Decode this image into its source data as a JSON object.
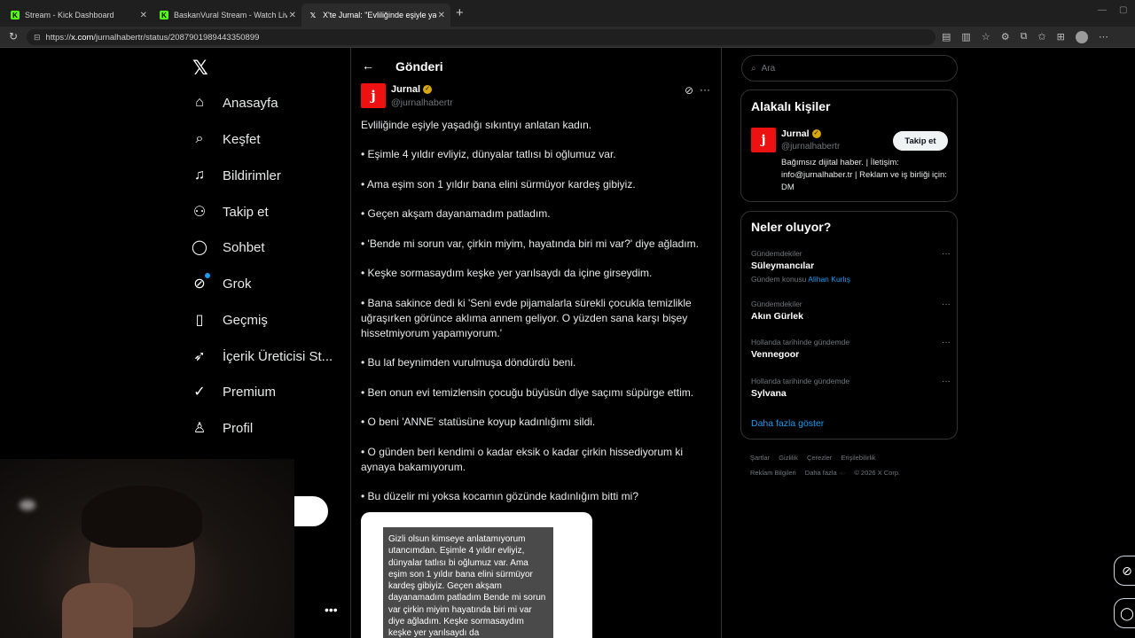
{
  "browser": {
    "tabs": [
      {
        "label": "Stream - Kick Dashboard",
        "favicon": "kick-icon"
      },
      {
        "label": "BaskanVural Stream - Watch Live o",
        "favicon": "kick-icon"
      },
      {
        "label": "X'te Jurnal: \"Evliliğinde eşiyle yaşa",
        "favicon": "x-icon"
      }
    ],
    "url": "https://x.com/jurnalhabertr/status/2087901989443350899",
    "url_host": "x.com",
    "url_prefix": "https://",
    "url_path": "/jurnalhabertr/status/2087901989443350899"
  },
  "nav": {
    "logo": "𝕏",
    "items": [
      {
        "label": "Anasayfa",
        "icon": "home-icon"
      },
      {
        "label": "Keşfet",
        "icon": "search-icon"
      },
      {
        "label": "Bildirimler",
        "icon": "bell-icon"
      },
      {
        "label": "Takip et",
        "icon": "add-user-icon"
      },
      {
        "label": "Sohbet",
        "icon": "chat-icon"
      },
      {
        "label": "Grok",
        "icon": "grok-icon"
      },
      {
        "label": "Geçmiş",
        "icon": "bookmark-icon"
      },
      {
        "label": "İçerik Üreticisi St...",
        "icon": "rocket-icon"
      },
      {
        "label": "Premium",
        "icon": "verified-icon"
      },
      {
        "label": "Profil",
        "icon": "profile-icon"
      }
    ],
    "more": "•••"
  },
  "main": {
    "header_title": "Gönderi",
    "author_name": "Jurnal",
    "author_handle": "@jurnalhabertr",
    "paragraphs": [
      "Evliliğinde eşiyle yaşadığı sıkıntıyı anlatan kadın.",
      "• Eşimle 4 yıldır evliyiz, dünyalar tatlısı bi oğlumuz var.",
      "• Ama eşim son 1 yıldır bana elini sürmüyor kardeş gibiyiz.",
      "• Geçen akşam dayanamadım patladım.",
      "• 'Bende mi sorun var, çirkin miyim, hayatında biri mi var?' diye ağladım.",
      "• Keşke sormasaydım keşke yer yarılsaydı da içine girseydim.",
      "• Bana sakince dedi ki 'Seni evde pijamalarla sürekli çocukla temizlikle uğraşırken görünce aklıma annem geliyor. O yüzden sana karşı bişey hissetmiyorum yapamıyorum.'",
      "• Bu laf beynimden vurulmuşa döndürdü beni.",
      "• Ben onun evi temizlensin çocuğu büyüsün diye saçımı süpürge ettim.",
      "• O beni 'ANNE' statüsüne koyup kadınlığımı sildi.",
      "• O günden beri kendimi o kadar eksik o kadar çirkin hissediyorum ki aynaya bakamıyorum.",
      "• Bu düzelir mi yoksa kocamın gözünde kadınlığım bitti mi?"
    ],
    "image_text": "Gizli olsun kimseye anlatamıyorum utancımdan. Eşimle 4 yıldır evliyiz, dünyalar tatlısı bi oğlumuz var. Ama eşim son 1 yıldır bana elini sürmüyor kardeş gibiyiz. Geçen akşam dayanamadım patladım Bende mi sorun var çirkin miyim hayatında biri mi var diye ağladım. Keşke sormasaydım keşke yer yarılsaydı da"
  },
  "right": {
    "search_placeholder": "Ara",
    "related": {
      "title": "Alakalı kişiler",
      "name": "Jurnal",
      "handle": "@jurnalhabertr",
      "follow_label": "Takip et",
      "bio": "Bağımsız dijital haber. | İletişim: info@jurnalhaber.tr | Reklam ve iş birliği için: DM"
    },
    "trends": {
      "title": "Neler oluyor?",
      "items": [
        {
          "context": "Gündemdekiler",
          "name": "Süleymancılar",
          "sub_prefix": "Gündem konusu",
          "sub_link": "Alihan Kurlış"
        },
        {
          "context": "Gündemdekiler",
          "name": "Akın Gürlek"
        },
        {
          "context": "Hollanda tarihinde gündemde",
          "name": "Vennegoor"
        },
        {
          "context": "Hollanda tarihinde gündemde",
          "name": "Sylvana"
        }
      ],
      "show_more": "Daha fazla göster"
    },
    "footer_row1": [
      "Şartlar",
      "Gizlilik",
      "Çerezler",
      "Erişilebilirlik"
    ],
    "footer_row2": [
      "Reklam Bilgileri",
      "Daha fazla ···",
      "© 2026 X Corp."
    ]
  },
  "webcam_badge": "ʃ"
}
